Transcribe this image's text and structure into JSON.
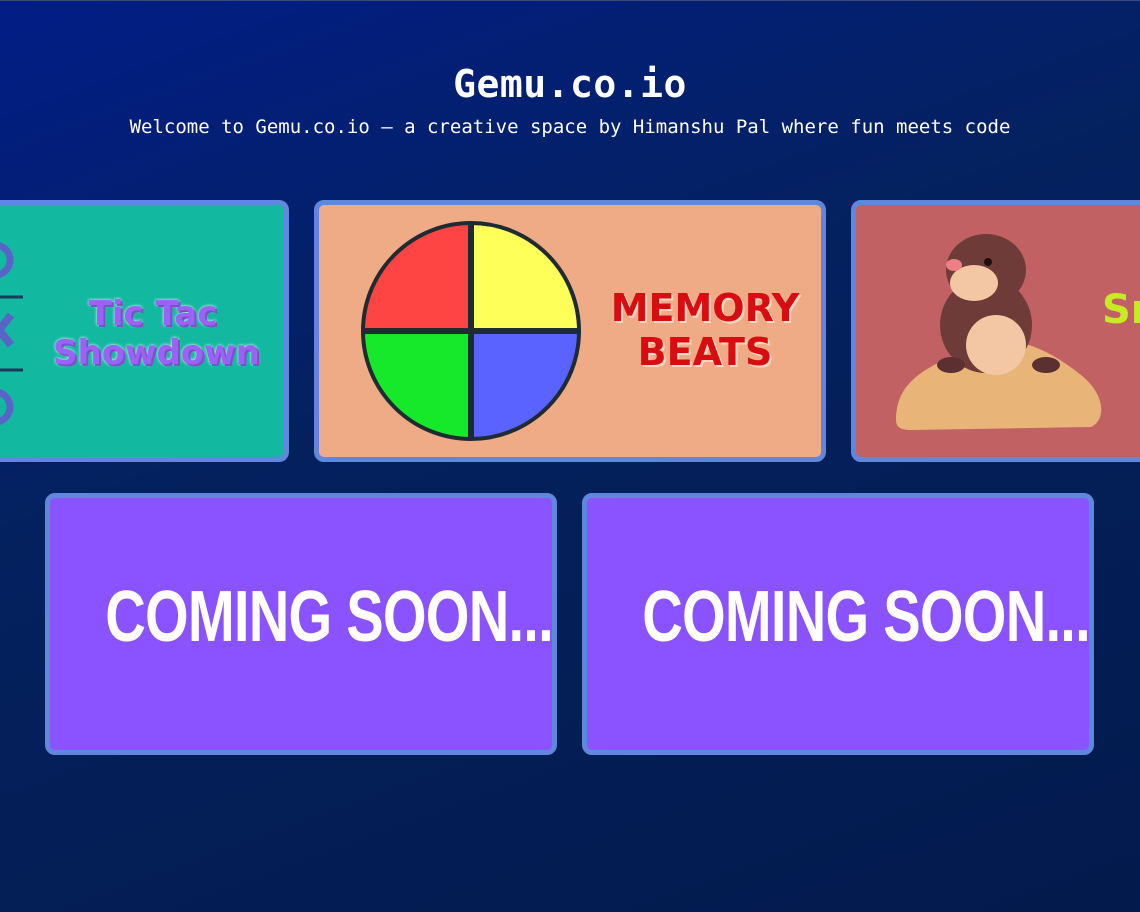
{
  "header": {
    "title": "Gemu.co.io",
    "subtitle": "Welcome to Gemu.co.io — a creative space by Himanshu Pal where fun meets code"
  },
  "games": [
    {
      "title_line1": "Tic Tac",
      "title_line2": "Showdown",
      "background": "#13b8a0",
      "icon": "tic-tac-toe-icon"
    },
    {
      "title_line1": "MEMORY",
      "title_line2": "BEATS",
      "background": "#efab85",
      "icon": "simon-wheel-icon"
    },
    {
      "title_line1": "Sn",
      "background": "#c26164",
      "icon": "mole-icon"
    }
  ],
  "coming_soon": [
    {
      "label": "COMING SOON...."
    },
    {
      "label": "COMING SOON...."
    }
  ],
  "colors": {
    "card_border": "#5f87dd",
    "coming_soon_bg": "#8b52ff",
    "page_bg": "#031f6b"
  }
}
